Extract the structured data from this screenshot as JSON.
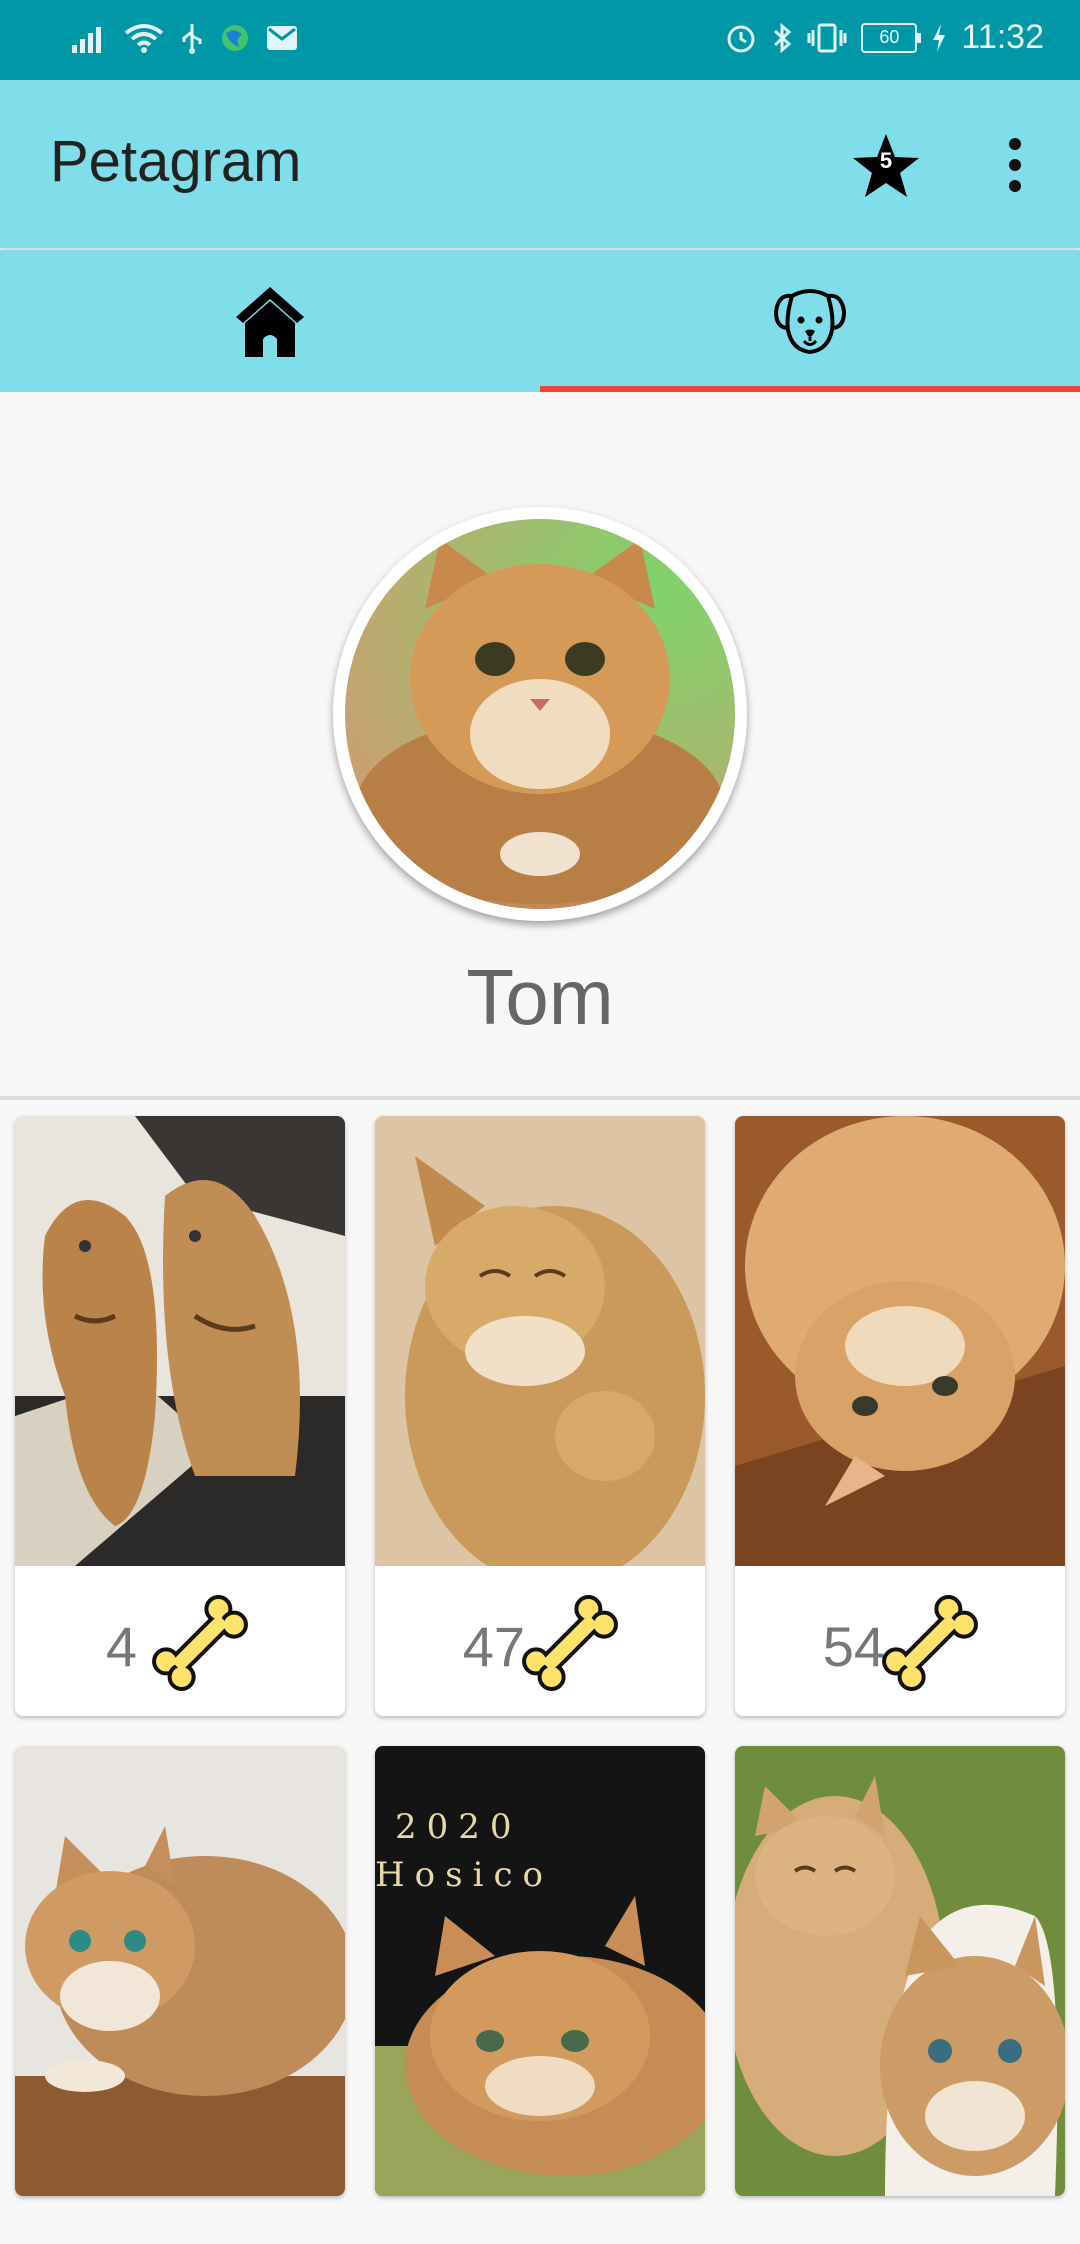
{
  "status": {
    "time": "11:32",
    "battery": "60"
  },
  "app": {
    "title": "Petagram",
    "favorites_count": "5"
  },
  "tabs": [
    {
      "name": "home",
      "icon": "house-icon",
      "selected": false
    },
    {
      "name": "pet",
      "icon": "dog-face-icon",
      "selected": true
    }
  ],
  "profile": {
    "name": "Tom"
  },
  "photos": [
    {
      "count": "4"
    },
    {
      "count": "47"
    },
    {
      "count": "54"
    }
  ],
  "colors": {
    "status_bar": "#0097a7",
    "app_bar": "#80deea",
    "tab_indicator": "#f44336",
    "bone": "#ffe26a"
  }
}
